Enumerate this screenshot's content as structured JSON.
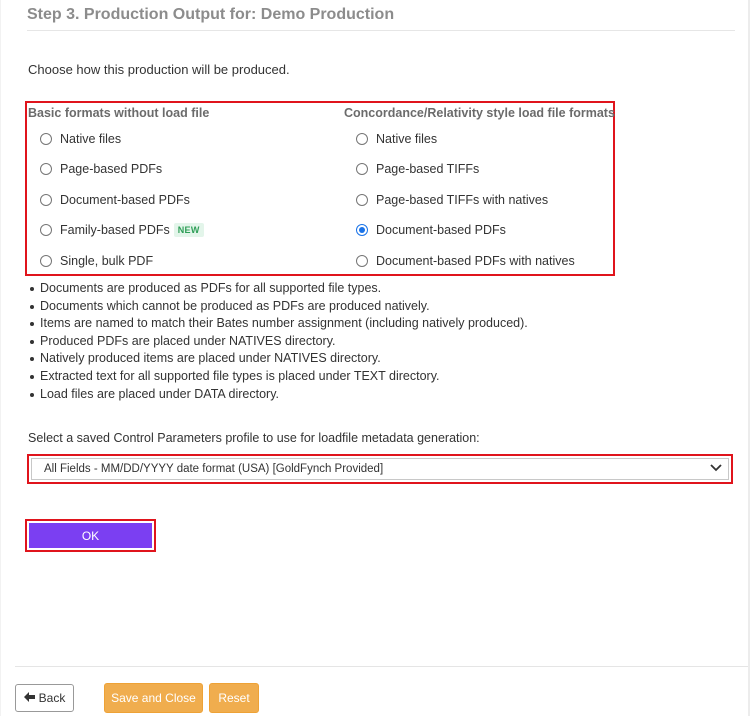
{
  "header": {
    "title": "Step 3. Production Output for: Demo Production"
  },
  "intro": "Choose how this production will be produced.",
  "formats": {
    "left": {
      "heading": "Basic formats without load file",
      "options": [
        {
          "label": "Native files",
          "checked": false
        },
        {
          "label": "Page-based PDFs",
          "checked": false
        },
        {
          "label": "Document-based PDFs",
          "checked": false
        },
        {
          "label": "Family-based PDFs",
          "badge": "NEW",
          "checked": false
        },
        {
          "label": "Single, bulk PDF",
          "checked": false
        }
      ]
    },
    "right": {
      "heading": "Concordance/Relativity style load file formats",
      "options": [
        {
          "label": "Native files",
          "checked": false
        },
        {
          "label": "Page-based TIFFs",
          "checked": false
        },
        {
          "label": "Page-based TIFFs with natives",
          "checked": false
        },
        {
          "label": "Document-based PDFs",
          "checked": true
        },
        {
          "label": "Document-based PDFs with natives",
          "checked": false
        }
      ]
    }
  },
  "notes": [
    "Documents are produced as PDFs for all supported file types.",
    "Documents which cannot be produced as PDFs are produced natively.",
    "Items are named to match their Bates number assignment (including natively produced).",
    "Produced PDFs are placed under NATIVES directory.",
    "Natively produced items are placed under NATIVES directory.",
    "Extracted text for all supported file types is placed under TEXT directory.",
    "Load files are placed under DATA directory."
  ],
  "control_params": {
    "label": "Select a saved Control Parameters profile to use for loadfile metadata generation:",
    "selected": "All Fields - MM/DD/YYYY date format (USA) [GoldFynch Provided]"
  },
  "buttons": {
    "ok": "OK",
    "back": "Back",
    "save_close": "Save and Close",
    "reset": "Reset"
  },
  "colors": {
    "highlight": "#e0141c",
    "ok_button": "#7b3ff2",
    "action_button": "#f0ad4e",
    "radio_checked": "#1a73e8",
    "badge_green": "#2e9e57"
  },
  "icons": {
    "back": "arrow-left-icon",
    "select": "chevron-down-icon"
  }
}
